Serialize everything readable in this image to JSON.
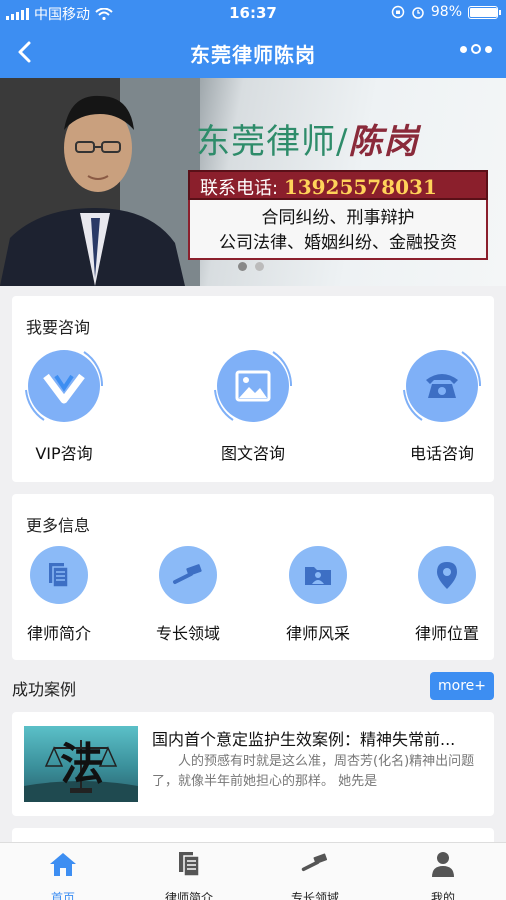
{
  "status_bar": {
    "carrier": "中国移动",
    "time": "16:37",
    "battery": "98%",
    "battery_level": 0.98
  },
  "nav": {
    "title": "东莞律师陈岗",
    "back_icon": "chevron-left-icon",
    "more_icon": "more-dots-icon"
  },
  "banner": {
    "headline": "东莞律师/",
    "name": "陈岗",
    "phone_label": "联系电话:",
    "phone_number": "13925578031",
    "services_line1": "合同纠纷、刑事辩护",
    "services_line2": "公司法律、婚姻纠纷、金融投资",
    "slide_count": 2,
    "active_slide": 1
  },
  "consult": {
    "title": "我要咨询",
    "items": [
      {
        "label": "VIP咨询",
        "icon": "vip-icon"
      },
      {
        "label": "图文咨询",
        "icon": "image-icon"
      },
      {
        "label": "电话咨询",
        "icon": "telephone-icon"
      }
    ]
  },
  "more_info": {
    "title": "更多信息",
    "items": [
      {
        "label": "律师简介",
        "icon": "document-icon"
      },
      {
        "label": "专长领域",
        "icon": "gavel-icon"
      },
      {
        "label": "律师风采",
        "icon": "folder-person-icon"
      },
      {
        "label": "律师位置",
        "icon": "location-pin-icon"
      }
    ]
  },
  "cases": {
    "title": "成功案例",
    "more_label": "more+",
    "items": [
      {
        "title": "国内首个意定监护生效案例：精神失常前...",
        "desc": "人的预感有时就是这么准，周杏芳(化名)精神出问题了，就像半年前她担心的那样。    她先是",
        "image_text": "法"
      }
    ]
  },
  "tabbar": {
    "items": [
      {
        "label": "首页",
        "icon": "home-icon",
        "active": true
      },
      {
        "label": "律师简介",
        "icon": "document-icon",
        "active": false
      },
      {
        "label": "专长领域",
        "icon": "gavel-icon",
        "active": false
      },
      {
        "label": "我的",
        "icon": "user-icon",
        "active": false
      }
    ]
  },
  "colors": {
    "primary": "#3d8ef2",
    "icon_bg": "#7fb0f7",
    "banner_red": "#8b1f2c"
  }
}
